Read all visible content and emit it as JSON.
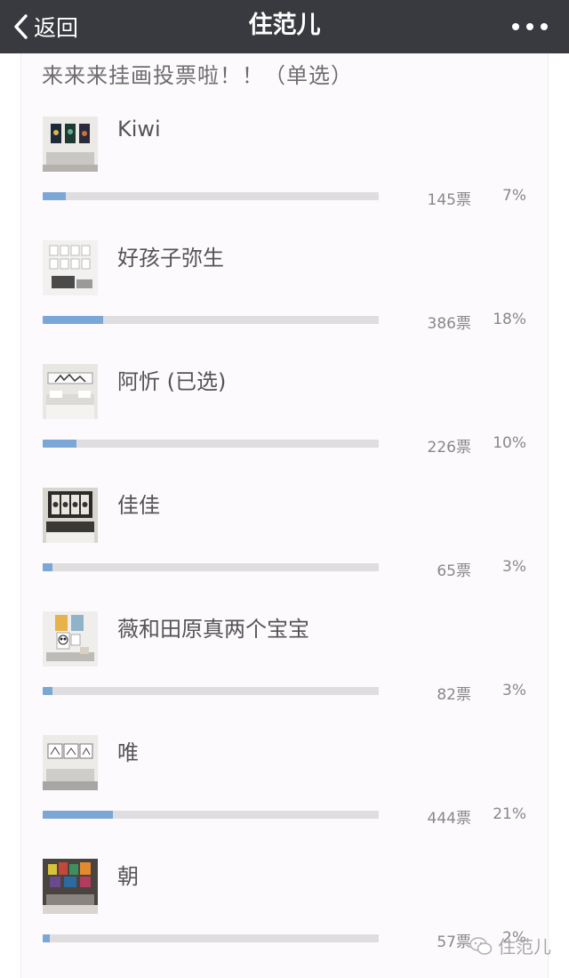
{
  "navbar": {
    "back_label": "返回",
    "title": "住范儿"
  },
  "poll": {
    "question": "来来来挂画投票啦！！（单选）",
    "options": [
      {
        "label": "Kiwi",
        "votes": "145票",
        "percent": "7%",
        "fraction": 0.07,
        "thumb_icon": "wall-art-three-panels-thumbnail"
      },
      {
        "label": "好孩子弥生",
        "votes": "386票",
        "percent": "18%",
        "fraction": 0.18,
        "thumb_icon": "wall-art-grid-thumbnail"
      },
      {
        "label": "阿忻 (已选)",
        "votes": "226票",
        "percent": "10%",
        "fraction": 0.1,
        "thumb_icon": "wall-art-bedroom-thumbnail"
      },
      {
        "label": "佳佳",
        "votes": "65票",
        "percent": "3%",
        "fraction": 0.03,
        "thumb_icon": "wall-art-moon-panels-thumbnail"
      },
      {
        "label": "薇和田原真两个宝宝",
        "votes": "82票",
        "percent": "3%",
        "fraction": 0.03,
        "thumb_icon": "wall-art-panda-prints-thumbnail"
      },
      {
        "label": "唯",
        "votes": "444票",
        "percent": "21%",
        "fraction": 0.21,
        "thumb_icon": "wall-art-sketch-frames-thumbnail"
      },
      {
        "label": "朝",
        "votes": "57票",
        "percent": "2%",
        "fraction": 0.02,
        "thumb_icon": "wall-art-colorful-frames-thumbnail"
      }
    ]
  },
  "watermark": {
    "text": "住范儿",
    "icon": "wechat-icon"
  },
  "colors": {
    "navbar_bg": "#393a3f",
    "bar_fill": "#7aa7d5",
    "bar_track": "#dedde0"
  }
}
